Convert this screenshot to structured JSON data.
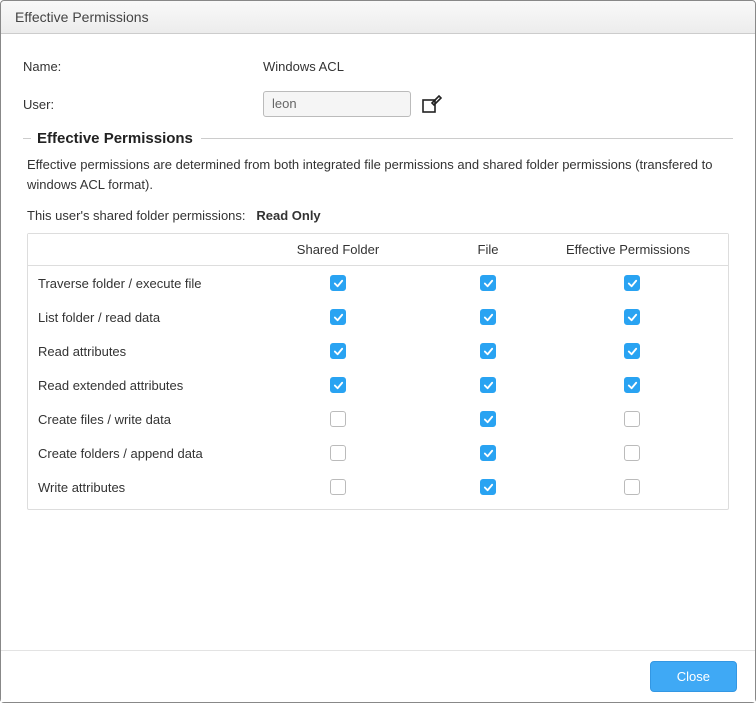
{
  "window": {
    "title": "Effective Permissions"
  },
  "form": {
    "name_label": "Name:",
    "name_value": "Windows ACL",
    "user_label": "User:",
    "user_value": "leon"
  },
  "fieldset": {
    "legend": "Effective Permissions",
    "description": "Effective permissions are determined from both integrated file permissions and shared folder permissions (transfered to windows ACL format).",
    "perm_label": "This user's shared folder permissions:",
    "perm_value": "Read Only"
  },
  "table": {
    "headers": {
      "permission": "",
      "shared": "Shared Folder",
      "file": "File",
      "effective": "Effective Permissions"
    },
    "rows": [
      {
        "label": "Traverse folder / execute file",
        "shared": true,
        "file": true,
        "effective": true
      },
      {
        "label": "List folder / read data",
        "shared": true,
        "file": true,
        "effective": true
      },
      {
        "label": "Read attributes",
        "shared": true,
        "file": true,
        "effective": true
      },
      {
        "label": "Read extended attributes",
        "shared": true,
        "file": true,
        "effective": true
      },
      {
        "label": "Create files / write data",
        "shared": false,
        "file": true,
        "effective": false
      },
      {
        "label": "Create folders / append data",
        "shared": false,
        "file": true,
        "effective": false
      },
      {
        "label": "Write attributes",
        "shared": false,
        "file": true,
        "effective": false
      }
    ]
  },
  "footer": {
    "close_label": "Close"
  }
}
